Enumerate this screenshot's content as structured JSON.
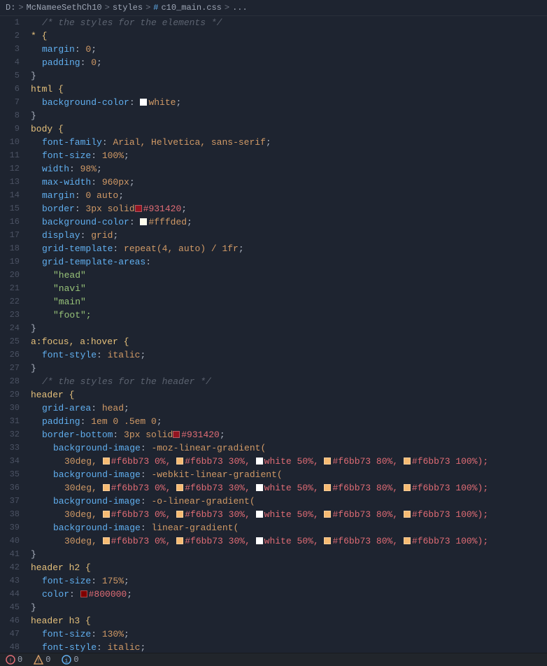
{
  "breadcrumb": {
    "drive": "D:",
    "sep1": ">",
    "folder1": "McNameeSethCh10",
    "sep2": ">",
    "folder2": "styles",
    "sep3": ">",
    "hash": "#",
    "file": "c10_main.css",
    "sep4": ">",
    "ellipsis": "..."
  },
  "statusbar": {
    "errors": "0",
    "warnings": "0",
    "info": "0"
  },
  "lines": [
    {
      "num": 1,
      "indent": 1,
      "content": "comment",
      "text": "/* the styles for the elements */"
    },
    {
      "num": 2,
      "indent": 0,
      "content": "selector",
      "text": "* {"
    },
    {
      "num": 3,
      "indent": 1,
      "content": "prop-val",
      "prop": "margin",
      "val": "0",
      "semi": ";"
    },
    {
      "num": 4,
      "indent": 1,
      "content": "prop-val",
      "prop": "padding",
      "val": "0",
      "semi": ";"
    },
    {
      "num": 5,
      "indent": 0,
      "content": "brace",
      "text": "}"
    },
    {
      "num": 6,
      "indent": 0,
      "content": "selector",
      "text": "html {"
    },
    {
      "num": 7,
      "indent": 1,
      "content": "prop-color",
      "prop": "background-color",
      "color": "#ffffff",
      "colorname": "white",
      "semi": ";"
    },
    {
      "num": 8,
      "indent": 0,
      "content": "brace",
      "text": "}"
    },
    {
      "num": 9,
      "indent": 0,
      "content": "selector",
      "text": "body {"
    },
    {
      "num": 10,
      "indent": 1,
      "content": "prop-val",
      "prop": "font-family",
      "val": "Arial, Helvetica, sans-serif",
      "semi": ";"
    },
    {
      "num": 11,
      "indent": 1,
      "content": "prop-val",
      "prop": "font-size",
      "val": "100%",
      "semi": ";"
    },
    {
      "num": 12,
      "indent": 1,
      "content": "prop-val",
      "prop": "width",
      "val": "98%",
      "semi": ";"
    },
    {
      "num": 13,
      "indent": 1,
      "content": "prop-val",
      "prop": "max-width",
      "val": "960px",
      "semi": ";"
    },
    {
      "num": 14,
      "indent": 1,
      "content": "prop-val",
      "prop": "margin",
      "val": "0 auto",
      "semi": ";"
    },
    {
      "num": 15,
      "indent": 1,
      "content": "prop-border",
      "prop": "border",
      "val": "3px solid",
      "color": "#931420",
      "semi": ";"
    },
    {
      "num": 16,
      "indent": 1,
      "content": "prop-color",
      "prop": "background-color",
      "color": "#fffded",
      "colorname": "#fffded",
      "semi": ";"
    },
    {
      "num": 17,
      "indent": 1,
      "content": "prop-val",
      "prop": "display",
      "val": "grid",
      "semi": ";"
    },
    {
      "num": 18,
      "indent": 1,
      "content": "prop-val",
      "prop": "grid-template",
      "val": "repeat(4, auto) / 1fr",
      "semi": ";"
    },
    {
      "num": 19,
      "indent": 1,
      "content": "prop-only",
      "prop": "grid-template-areas",
      "semi": ":"
    },
    {
      "num": 20,
      "indent": 2,
      "content": "string",
      "text": "\"head\""
    },
    {
      "num": 21,
      "indent": 2,
      "content": "string",
      "text": "\"navi\""
    },
    {
      "num": 22,
      "indent": 2,
      "content": "string",
      "text": "\"main\""
    },
    {
      "num": 23,
      "indent": 2,
      "content": "string",
      "text": "\"foot\";"
    },
    {
      "num": 24,
      "indent": 0,
      "content": "brace",
      "text": "}"
    },
    {
      "num": 25,
      "indent": 0,
      "content": "selector",
      "text": "a:focus, a:hover {"
    },
    {
      "num": 26,
      "indent": 1,
      "content": "prop-val",
      "prop": "font-style",
      "val": "italic",
      "semi": ";"
    },
    {
      "num": 27,
      "indent": 0,
      "content": "brace",
      "text": "}"
    },
    {
      "num": 28,
      "indent": 1,
      "content": "comment",
      "text": "/* the styles for the header */"
    },
    {
      "num": 29,
      "indent": 0,
      "content": "selector",
      "text": "header {"
    },
    {
      "num": 30,
      "indent": 1,
      "content": "prop-val",
      "prop": "grid-area",
      "val": "head",
      "semi": ";"
    },
    {
      "num": 31,
      "indent": 1,
      "content": "prop-val",
      "prop": "padding",
      "val": "1em 0 .5em 0",
      "semi": ";"
    },
    {
      "num": 32,
      "indent": 1,
      "content": "prop-border",
      "prop": "border-bottom",
      "val": "3px solid",
      "color": "#931420",
      "semi": ";"
    },
    {
      "num": 33,
      "indent": 2,
      "content": "prop-val",
      "prop": "background-image",
      "val": "-moz-linear-gradient(",
      "semi": ""
    },
    {
      "num": 34,
      "indent": 3,
      "content": "gradient-line",
      "parts": [
        {
          "text": "30deg, ",
          "type": "num"
        },
        {
          "color": "#f6bb73",
          "type": "swatch"
        },
        {
          "text": "#f6bb73 0%, ",
          "type": "color"
        },
        {
          "color": "#f6bb73",
          "type": "swatch"
        },
        {
          "text": "#f6bb73 30%, ",
          "type": "color"
        },
        {
          "color": "#ffffff",
          "type": "swatch"
        },
        {
          "text": "white 50%, ",
          "type": "color"
        },
        {
          "color": "#f6bb73",
          "type": "swatch"
        },
        {
          "text": "#f6bb73 80%, ",
          "type": "color"
        },
        {
          "color": "#f6bb73",
          "type": "swatch"
        },
        {
          "text": "#f6bb73 100%);",
          "type": "color"
        }
      ]
    },
    {
      "num": 35,
      "indent": 2,
      "content": "prop-val",
      "prop": "background-image",
      "val": "-webkit-linear-gradient(",
      "semi": ""
    },
    {
      "num": 36,
      "indent": 3,
      "content": "gradient-line",
      "parts": [
        {
          "text": "30deg, ",
          "type": "num"
        },
        {
          "color": "#f6bb73",
          "type": "swatch"
        },
        {
          "text": "#f6bb73 0%, ",
          "type": "color"
        },
        {
          "color": "#f6bb73",
          "type": "swatch"
        },
        {
          "text": "#f6bb73 30%, ",
          "type": "color"
        },
        {
          "color": "#ffffff",
          "type": "swatch"
        },
        {
          "text": "white 50%, ",
          "type": "color"
        },
        {
          "color": "#f6bb73",
          "type": "swatch"
        },
        {
          "text": "#f6bb73 80%, ",
          "type": "color"
        },
        {
          "color": "#f6bb73",
          "type": "swatch"
        },
        {
          "text": "#f6bb73 100%);",
          "type": "color"
        }
      ]
    },
    {
      "num": 37,
      "indent": 2,
      "content": "prop-val",
      "prop": "background-image",
      "val": "-o-linear-gradient(",
      "semi": ""
    },
    {
      "num": 38,
      "indent": 3,
      "content": "gradient-line",
      "parts": [
        {
          "text": "30deg, ",
          "type": "num"
        },
        {
          "color": "#f6bb73",
          "type": "swatch"
        },
        {
          "text": "#f6bb73 0%, ",
          "type": "color"
        },
        {
          "color": "#f6bb73",
          "type": "swatch"
        },
        {
          "text": "#f6bb73 30%, ",
          "type": "color"
        },
        {
          "color": "#ffffff",
          "type": "swatch"
        },
        {
          "text": "white 50%, ",
          "type": "color"
        },
        {
          "color": "#f6bb73",
          "type": "swatch"
        },
        {
          "text": "#f6bb73 80%, ",
          "type": "color"
        },
        {
          "color": "#f6bb73",
          "type": "swatch"
        },
        {
          "text": "#f6bb73 100%);",
          "type": "color"
        }
      ]
    },
    {
      "num": 39,
      "indent": 2,
      "content": "prop-val",
      "prop": "background-image",
      "val": "linear-gradient(",
      "semi": ""
    },
    {
      "num": 40,
      "indent": 3,
      "content": "gradient-line",
      "parts": [
        {
          "text": "30deg, ",
          "type": "num"
        },
        {
          "color": "#f6bb73",
          "type": "swatch"
        },
        {
          "text": "#f6bb73 0%, ",
          "type": "color"
        },
        {
          "color": "#f6bb73",
          "type": "swatch"
        },
        {
          "text": "#f6bb73 30%, ",
          "type": "color"
        },
        {
          "color": "#ffffff",
          "type": "swatch"
        },
        {
          "text": "white 50%, ",
          "type": "color"
        },
        {
          "color": "#f6bb73",
          "type": "swatch"
        },
        {
          "text": "#f6bb73 80%, ",
          "type": "color"
        },
        {
          "color": "#f6bb73",
          "type": "swatch"
        },
        {
          "text": "#f6bb73 100%);",
          "type": "color"
        }
      ]
    },
    {
      "num": 41,
      "indent": 0,
      "content": "brace",
      "text": "}"
    },
    {
      "num": 42,
      "indent": 0,
      "content": "selector",
      "text": "header h2 {"
    },
    {
      "num": 43,
      "indent": 1,
      "content": "prop-val",
      "prop": "font-size",
      "val": "175%",
      "semi": ";"
    },
    {
      "num": 44,
      "indent": 1,
      "content": "prop-border",
      "prop": "color",
      "val": "",
      "color": "#800000",
      "colorname": "#800000",
      "semi": ";"
    },
    {
      "num": 45,
      "indent": 0,
      "content": "brace",
      "text": "}"
    },
    {
      "num": 46,
      "indent": 0,
      "content": "selector",
      "text": "header h3 {"
    },
    {
      "num": 47,
      "indent": 1,
      "content": "prop-val",
      "prop": "font-size",
      "val": "130%",
      "semi": ";"
    },
    {
      "num": 48,
      "indent": 1,
      "content": "prop-val",
      "prop": "font-style",
      "val": "italic",
      "semi": ";"
    }
  ]
}
